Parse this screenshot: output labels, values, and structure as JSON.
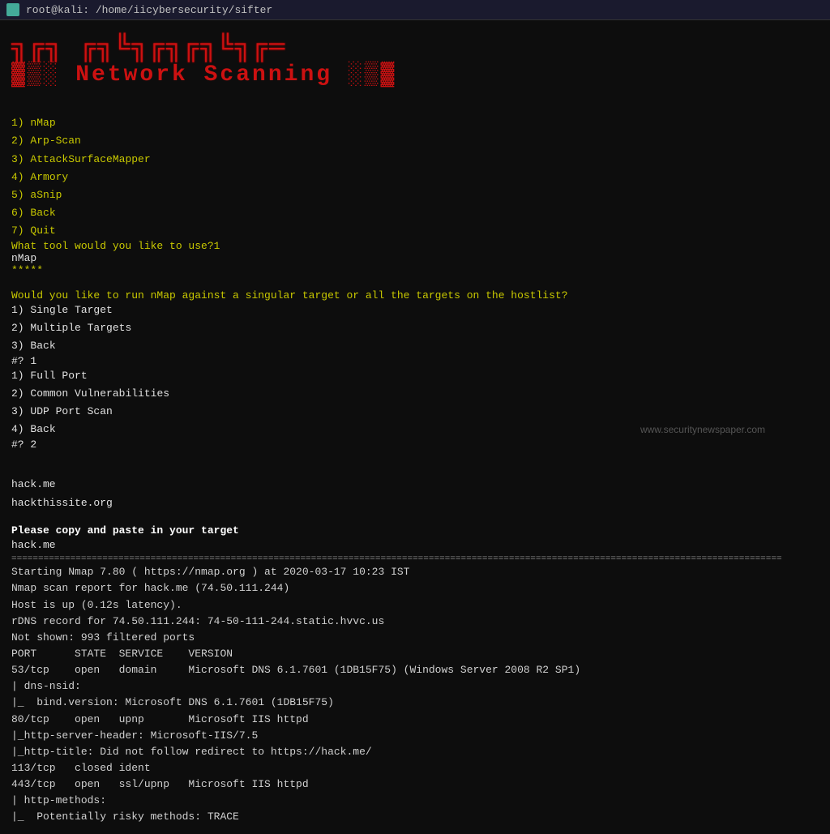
{
  "titleBar": {
    "icon": "terminal-icon",
    "title": "root@kali: /home/iicybersecurity/sifter"
  },
  "asciiArt": {
    "line1": "███╗░░██╗███████╗████████╗░██╗░░░░░░░██╗░█████╗░██████╗░██╗░░██╗",
    "line2": "████╗░██║██╔════╝╚══██╔══╝░██║░░██╗░░██║██╔══██╗██╔══██╗██║░██╔╝",
    "display1": "N̲e̲t̲w̲o̲r̲k̲ ̲S̲c̲a̲n̲n̲i̲n̲g̲"
  },
  "menu": {
    "items": [
      {
        "num": "1)",
        "label": "nMap"
      },
      {
        "num": "2)",
        "label": "Arp-Scan"
      },
      {
        "num": "3)",
        "label": "AttackSurfaceMapper"
      },
      {
        "num": "4)",
        "label": "Armory"
      },
      {
        "num": "5)",
        "label": "aSnip"
      },
      {
        "num": "6)",
        "label": "Back"
      },
      {
        "num": "7)",
        "label": "Quit"
      }
    ]
  },
  "prompts": {
    "toolPrompt": "What tool would you like to use?1",
    "toolAnswer": "nMap",
    "stars": "*****",
    "targetQuestion": "Would you like to run nMap against a singular target or all the targets on the hostlist?",
    "targetOptions": [
      {
        "num": "1)",
        "label": "Single Target"
      },
      {
        "num": "2)",
        "label": "Multiple Targets"
      },
      {
        "num": "3)",
        "label": "Back"
      }
    ],
    "prompt1": "#? 1",
    "scanOptions": [
      {
        "num": "1)",
        "label": "Full Port"
      },
      {
        "num": "2)",
        "label": "Common Vulnerabilities"
      },
      {
        "num": "3)",
        "label": "UDP Port Scan"
      },
      {
        "num": "4)",
        "label": "Back"
      }
    ],
    "prompt2": "#? 2",
    "targets": [
      "hack.me",
      "hackthissite.org"
    ],
    "copyPastePrompt": "Please copy and paste in your target",
    "targetInput": "hack.me"
  },
  "nmapOutput": {
    "separator": "================================================================================",
    "line1": "Starting Nmap 7.80 ( https://nmap.org ) at 2020-03-17 10:23 IST",
    "line2": "Nmap scan report for hack.me (74.50.111.244)",
    "line3": "Host is up (0.12s latency).",
    "line4": "rDNS record for 74.50.111.244: 74-50-111-244.static.hvvc.us",
    "line5": "Not shown: 993 filtered ports",
    "tableHeader": "PORT      STATE  SERVICE    VERSION",
    "port1": "53/tcp    open   domain     Microsoft DNS 6.1.7601 (1DB15F75) (Windows Server 2008 R2 SP1)",
    "dns_nsid": "| dns-nsid:",
    "bind_version": "|_  bind.version: Microsoft DNS 6.1.7601 (1DB15F75)",
    "port2": "80/tcp    open   upnp       Microsoft IIS httpd",
    "http_server": "|_http-server-header: Microsoft-IIS/7.5",
    "http_title": "|_http-title: Did not follow redirect to https://hack.me/",
    "port3": "113/tcp   closed ident",
    "port4": "443/tcp   open   ssl/upnp   Microsoft IIS httpd",
    "http_methods": "| http-methods:",
    "risky_methods": "|_  Potentially risky methods: TRACE"
  },
  "watermark": "www.securitynewspaper.com"
}
